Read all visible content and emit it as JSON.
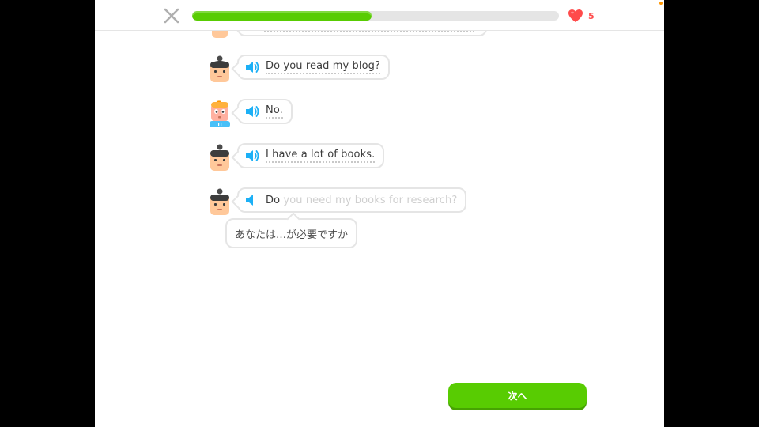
{
  "header": {
    "close_icon": "close-icon",
    "progress": 0.49,
    "hearts": "5",
    "heart_color": "#ff4b4b",
    "progress_color": "#58cc02"
  },
  "chat": [
    {
      "speaker": "man",
      "text": "Do you read my blog?",
      "dim_text": ""
    },
    {
      "speaker": "girl",
      "text": "No.",
      "dim_text": ""
    },
    {
      "speaker": "man",
      "text": "I have a lot of books.",
      "dim_text": ""
    },
    {
      "speaker": "man",
      "text": "Do",
      "dim_text": " you need my books for research?"
    }
  ],
  "tooltip": {
    "text": "あなたは…が必要ですか"
  },
  "footer": {
    "next_label": "次へ"
  }
}
